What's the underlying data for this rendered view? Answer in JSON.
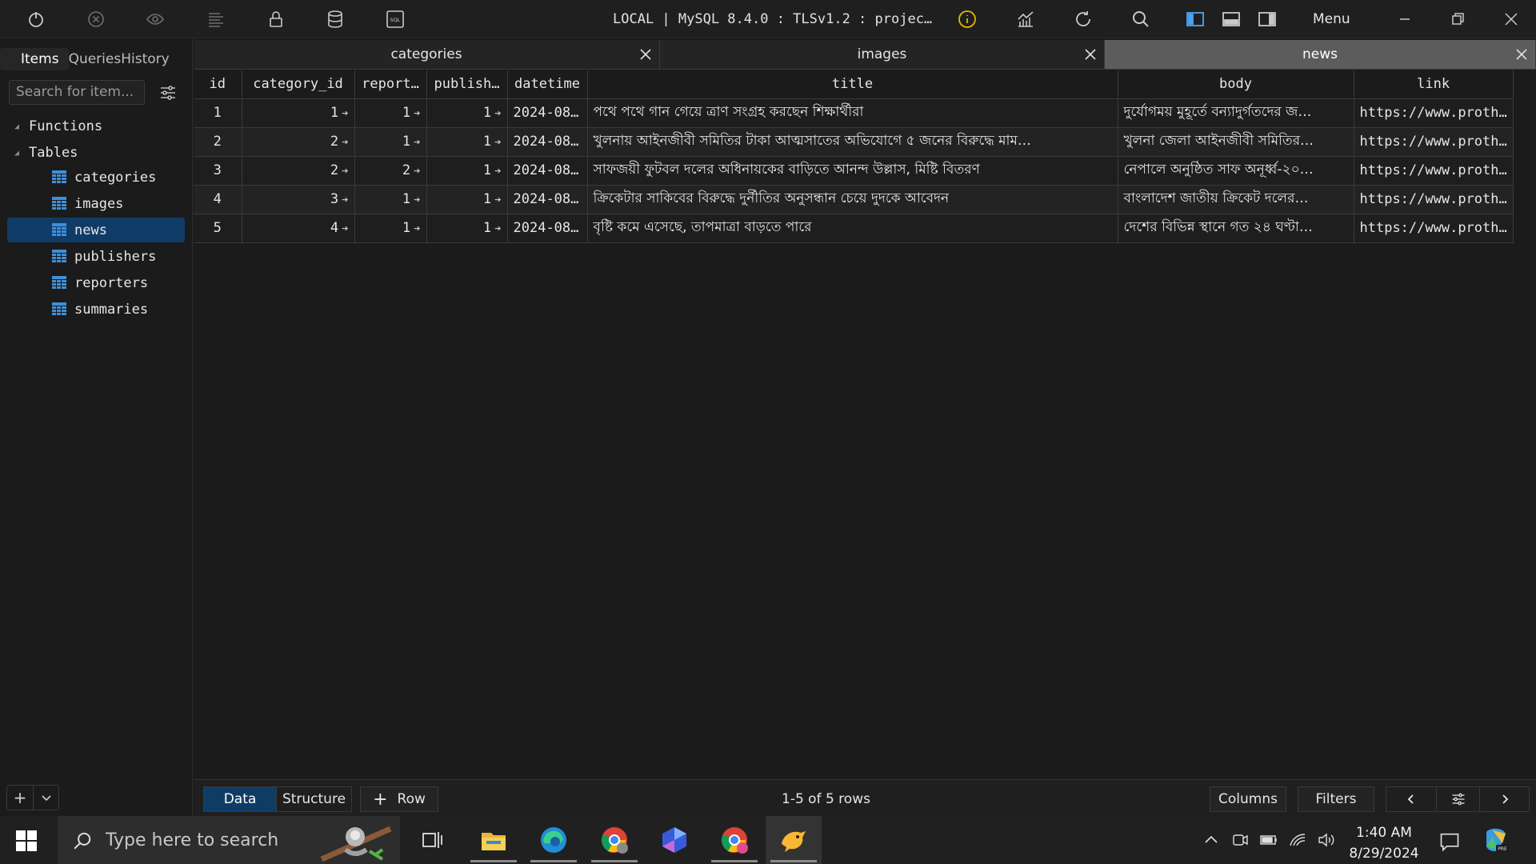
{
  "toolbar": {
    "connection": "LOCAL | MySQL 8.4.0 : TLSv1.2 : projec…",
    "menu": "Menu"
  },
  "sidebar": {
    "tabs": [
      "Items",
      "Queries",
      "History"
    ],
    "search_placeholder": "Search for item...",
    "groups": {
      "functions": "Functions",
      "tables": "Tables"
    },
    "tables": [
      "categories",
      "images",
      "news",
      "publishers",
      "reporters",
      "summaries"
    ],
    "selected_table": "news"
  },
  "tabs": [
    {
      "label": "categories",
      "active": false
    },
    {
      "label": "images",
      "active": false
    },
    {
      "label": "news",
      "active": true
    }
  ],
  "grid": {
    "columns": [
      "id",
      "category_id",
      "report…",
      "publish…",
      "datetime",
      "title",
      "body",
      "link"
    ],
    "rows": [
      {
        "id": "1",
        "category_id": "1",
        "reporter": "1",
        "publisher": "1",
        "datetime": "2024-08…",
        "title": "পথে পথে গান গেয়ে ত্রাণ সংগ্রহ করছেন শিক্ষার্থীরা",
        "body": "দুর্যোগময় মুহূর্তে বন্যাদুর্গতদের জ…",
        "link": "https://www.proth…"
      },
      {
        "id": "2",
        "category_id": "2",
        "reporter": "1",
        "publisher": "1",
        "datetime": "2024-08…",
        "title": "খুলনায় আইনজীবী সমিতির টাকা আত্মসাতের অভিযোগে ৫ জনের বিরুদ্ধে মাম…",
        "body": "খুলনা জেলা আইনজীবী সমিতির…",
        "link": "https://www.proth…"
      },
      {
        "id": "3",
        "category_id": "2",
        "reporter": "2",
        "publisher": "1",
        "datetime": "2024-08…",
        "title": "সাফজয়ী ফুটবল দলের অধিনায়কের বাড়িতে আনন্দ উল্লাস, মিষ্টি বিতরণ",
        "body": "নেপালে অনুষ্ঠিত সাফ অনূর্ধ্ব-২০…",
        "link": "https://www.proth…"
      },
      {
        "id": "4",
        "category_id": "3",
        "reporter": "1",
        "publisher": "1",
        "datetime": "2024-08…",
        "title": "ক্রিকেটার সাকিবের বিরুদ্ধে দুর্নীতির অনুসন্ধান চেয়ে দুদকে আবেদন",
        "body": "বাংলাদেশ জাতীয় ক্রিকেট দলের…",
        "link": "https://www.proth…"
      },
      {
        "id": "5",
        "category_id": "4",
        "reporter": "1",
        "publisher": "1",
        "datetime": "2024-08…",
        "title": "বৃষ্টি কমে এসেছে, তাপমাত্রা বাড়তে পারে",
        "body": "দেশের বিভিন্ন স্থানে গত ২৪ ঘণ্টা…",
        "link": "https://www.proth…"
      }
    ]
  },
  "bottom": {
    "data": "Data",
    "structure": "Structure",
    "add_row": "Row",
    "rows_info": "1-5 of 5 rows",
    "columns": "Columns",
    "filters": "Filters"
  },
  "taskbar": {
    "search_placeholder": "Type here to search",
    "time": "1:40 AM",
    "date": "8/29/2024"
  },
  "colors": {
    "accent": "#0f3c67",
    "active_tab": "#5c5c5c",
    "info": "#e6b800"
  }
}
